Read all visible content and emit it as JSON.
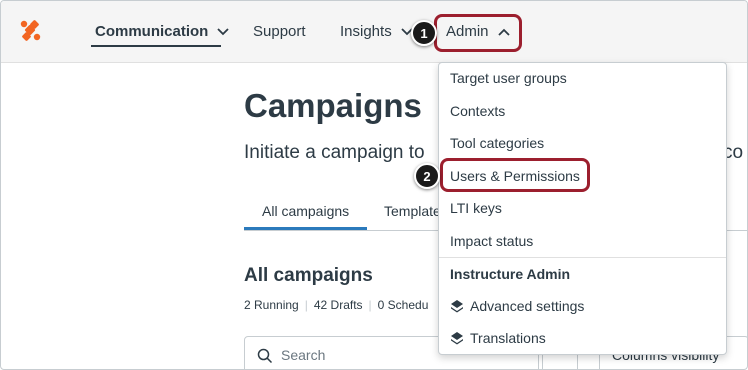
{
  "nav": {
    "communication": "Communication",
    "support": "Support",
    "insights": "Insights",
    "admin": "Admin"
  },
  "badges": {
    "step1": "1",
    "step2": "2"
  },
  "page": {
    "title": "Campaigns",
    "subtitle": "Initiate a campaign to",
    "subtitle_tail": "co",
    "tabs": [
      "All campaigns",
      "Template"
    ],
    "section_title": "All campaigns",
    "counts": [
      "2 Running",
      "42 Drafts",
      "0 Schedu"
    ],
    "search_placeholder": "Search",
    "columns_label": "Columns visibility"
  },
  "admin_menu": {
    "items": [
      "Target user groups",
      "Contexts",
      "Tool categories",
      "Users & Permissions",
      "LTI keys",
      "Impact status"
    ],
    "heading": "Instructure Admin",
    "sub_items": [
      {
        "label": "Advanced settings",
        "icon": "stack-icon"
      },
      {
        "label": "Translations",
        "icon": "stack-icon"
      }
    ]
  },
  "colors": {
    "highlight": "#9c1f2e",
    "brand_orange": "#f26522",
    "tab_active": "#2b7abc"
  }
}
